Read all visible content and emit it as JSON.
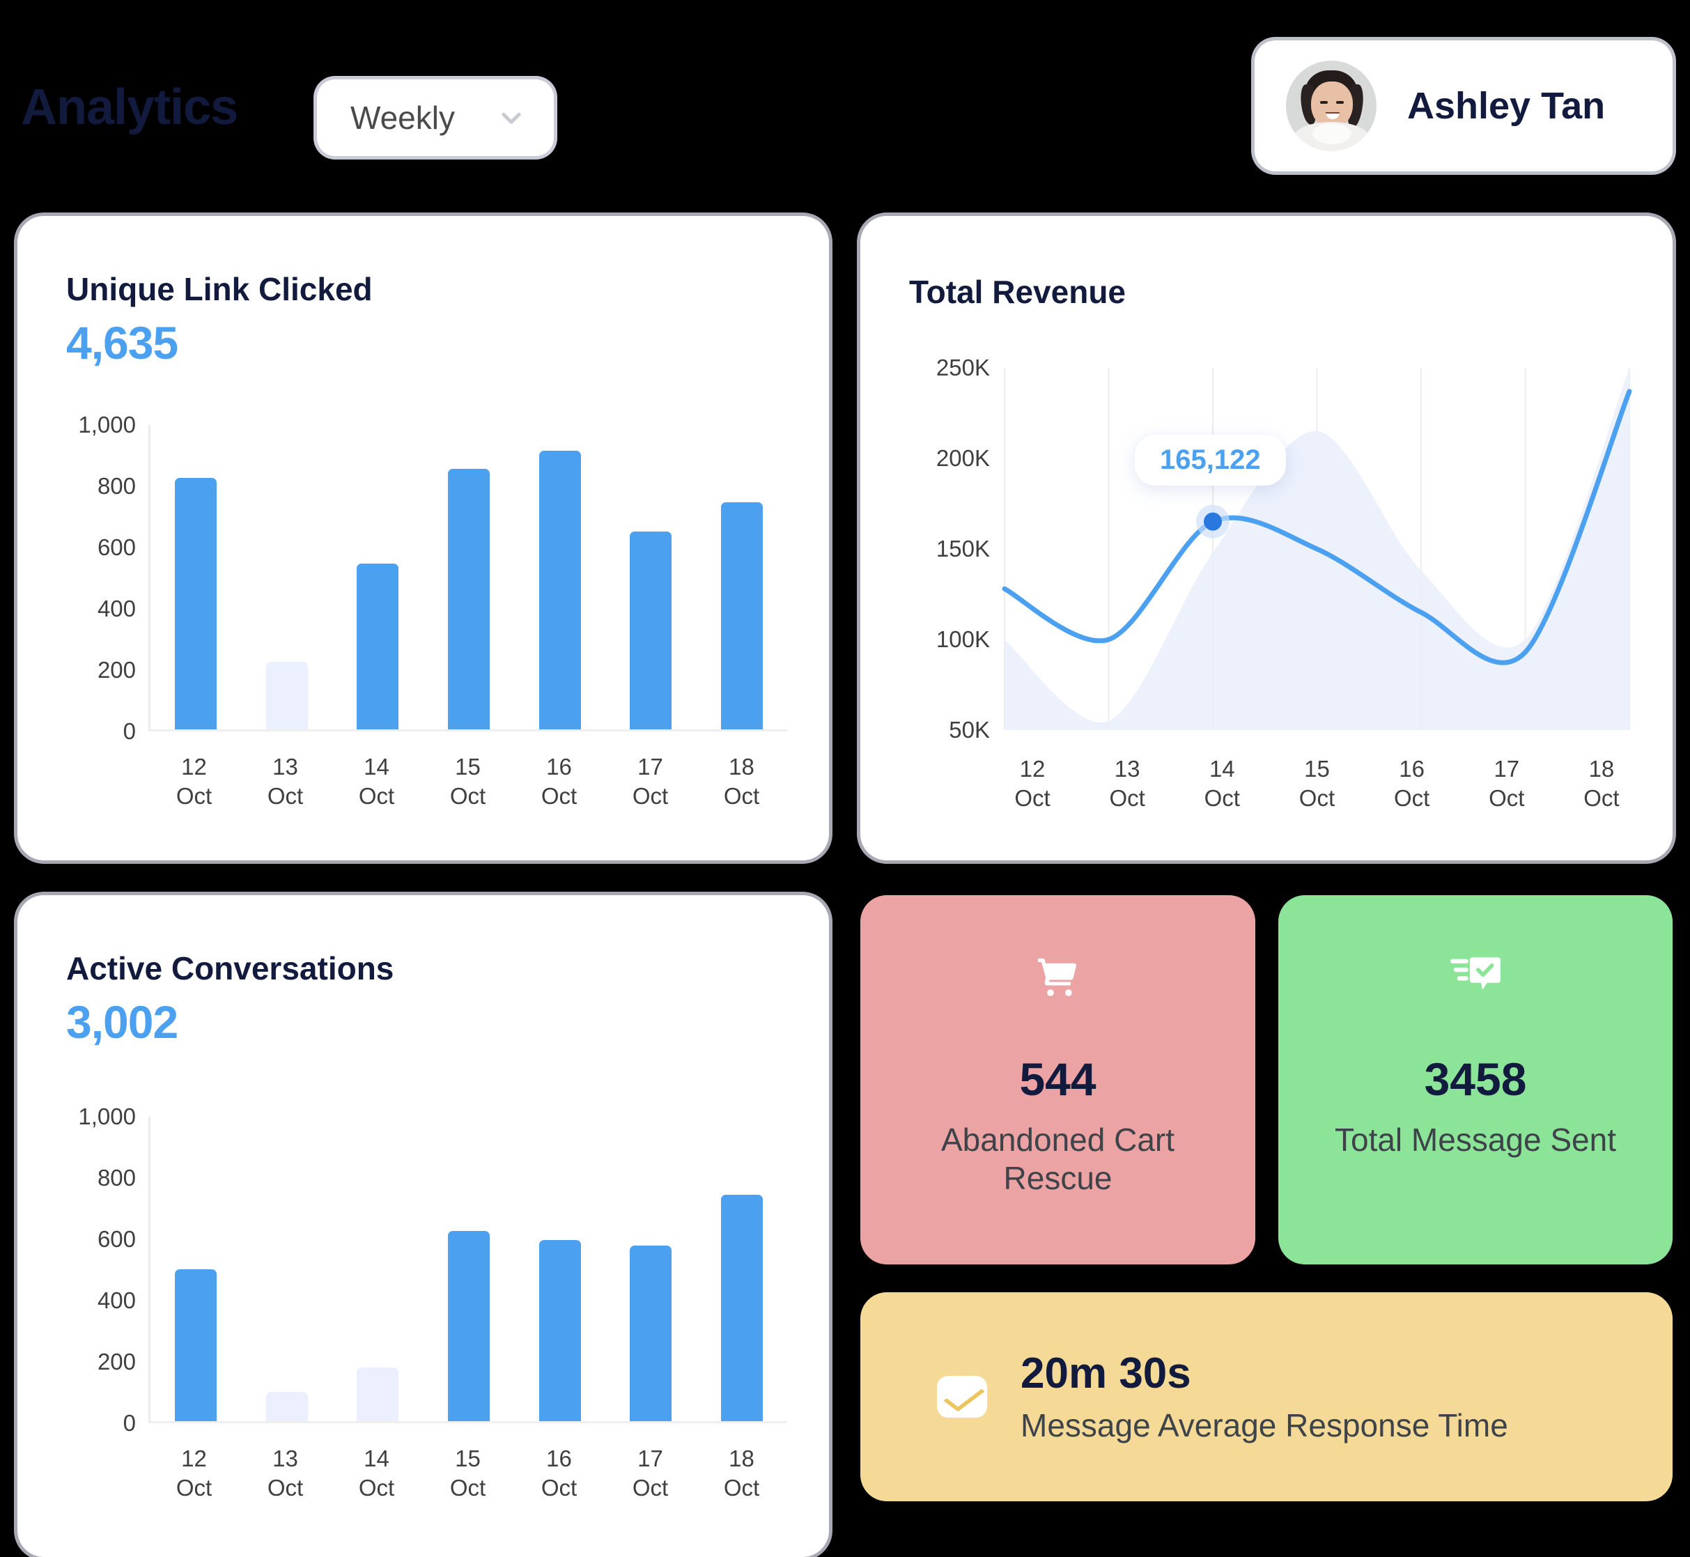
{
  "header": {
    "title": "Analytics",
    "period_label": "Weekly",
    "chevron_icon": "chevron-down-icon",
    "user_name": "Ashley Tan",
    "avatar_icon": "user-avatar-photo"
  },
  "cards": {
    "unique_link": {
      "title": "Unique Link Clicked",
      "value": "4,635"
    },
    "revenue": {
      "title": "Total Revenue",
      "tooltip_value": "165,122"
    },
    "conversations": {
      "title": "Active Conversations",
      "value": "3,002"
    }
  },
  "kpis": [
    {
      "id": "abandoned-cart-rescue",
      "icon": "shopping-cart-icon",
      "value": "544",
      "label": "Abandoned Cart Rescue",
      "color": "#eca3a3"
    },
    {
      "id": "total-message-sent",
      "icon": "message-sent-icon",
      "value": "3458",
      "label": "Total Message Sent",
      "color": "#8ce498"
    },
    {
      "id": "message-avg-response-time",
      "icon": "mail-icon",
      "value": "20m 30s",
      "label": "Message Average Response Time",
      "color": "#f4da96"
    }
  ],
  "colors": {
    "accent_blue": "#4ba0ef",
    "muted_bar": "#eceffd",
    "title_navy": "#121b3e",
    "page_background": "#000000",
    "card_background": "#ffffff"
  },
  "chart_data": [
    {
      "type": "bar",
      "title": "Unique Link Clicked",
      "total": "4,635",
      "categories": [
        "12 Oct",
        "13 Oct",
        "14 Oct",
        "15 Oct",
        "16 Oct",
        "17 Oct",
        "18 Oct"
      ],
      "values": [
        820,
        220,
        540,
        850,
        910,
        645,
        740
      ],
      "muted": [
        false,
        true,
        false,
        false,
        false,
        false,
        false
      ],
      "ylim": [
        0,
        1000
      ],
      "yticks": [
        "0",
        "200",
        "400",
        "600",
        "800",
        "1,000"
      ],
      "ytick_values": [
        0,
        200,
        400,
        600,
        800,
        1000
      ],
      "xlabel": "",
      "ylabel": "",
      "grid": false,
      "legend": "none"
    },
    {
      "type": "area",
      "title": "Total Revenue",
      "categories": [
        "12 Oct",
        "13 Oct",
        "14 Oct",
        "15 Oct",
        "16 Oct",
        "17 Oct",
        "18 Oct"
      ],
      "series": [
        {
          "name": "Revenue",
          "values": [
            128000,
            100000,
            165122,
            150000,
            115000,
            93000,
            237000
          ]
        },
        {
          "name": "Background band",
          "values": [
            100000,
            55000,
            148000,
            215000,
            138000,
            100000,
            250000
          ]
        }
      ],
      "ylim": [
        50000,
        250000
      ],
      "yticks": [
        "50K",
        "100K",
        "150K",
        "200K",
        "250K"
      ],
      "ytick_values": [
        50000,
        100000,
        150000,
        200000,
        250000
      ],
      "highlight": {
        "category": "14 Oct",
        "value": 165122,
        "label": "165,122"
      },
      "grid": true,
      "legend": "none"
    },
    {
      "type": "bar",
      "title": "Active Conversations",
      "total": "3,002",
      "categories": [
        "12 Oct",
        "13 Oct",
        "14 Oct",
        "15 Oct",
        "16 Oct",
        "17 Oct",
        "18 Oct"
      ],
      "values": [
        495,
        95,
        175,
        620,
        592,
        572,
        738
      ],
      "muted": [
        false,
        true,
        true,
        false,
        false,
        false,
        false
      ],
      "ylim": [
        0,
        1000
      ],
      "yticks": [
        "0",
        "200",
        "400",
        "600",
        "800",
        "1,000"
      ],
      "ytick_values": [
        0,
        200,
        400,
        600,
        800,
        1000
      ],
      "xlabel": "",
      "ylabel": "",
      "grid": false,
      "legend": "none"
    }
  ]
}
